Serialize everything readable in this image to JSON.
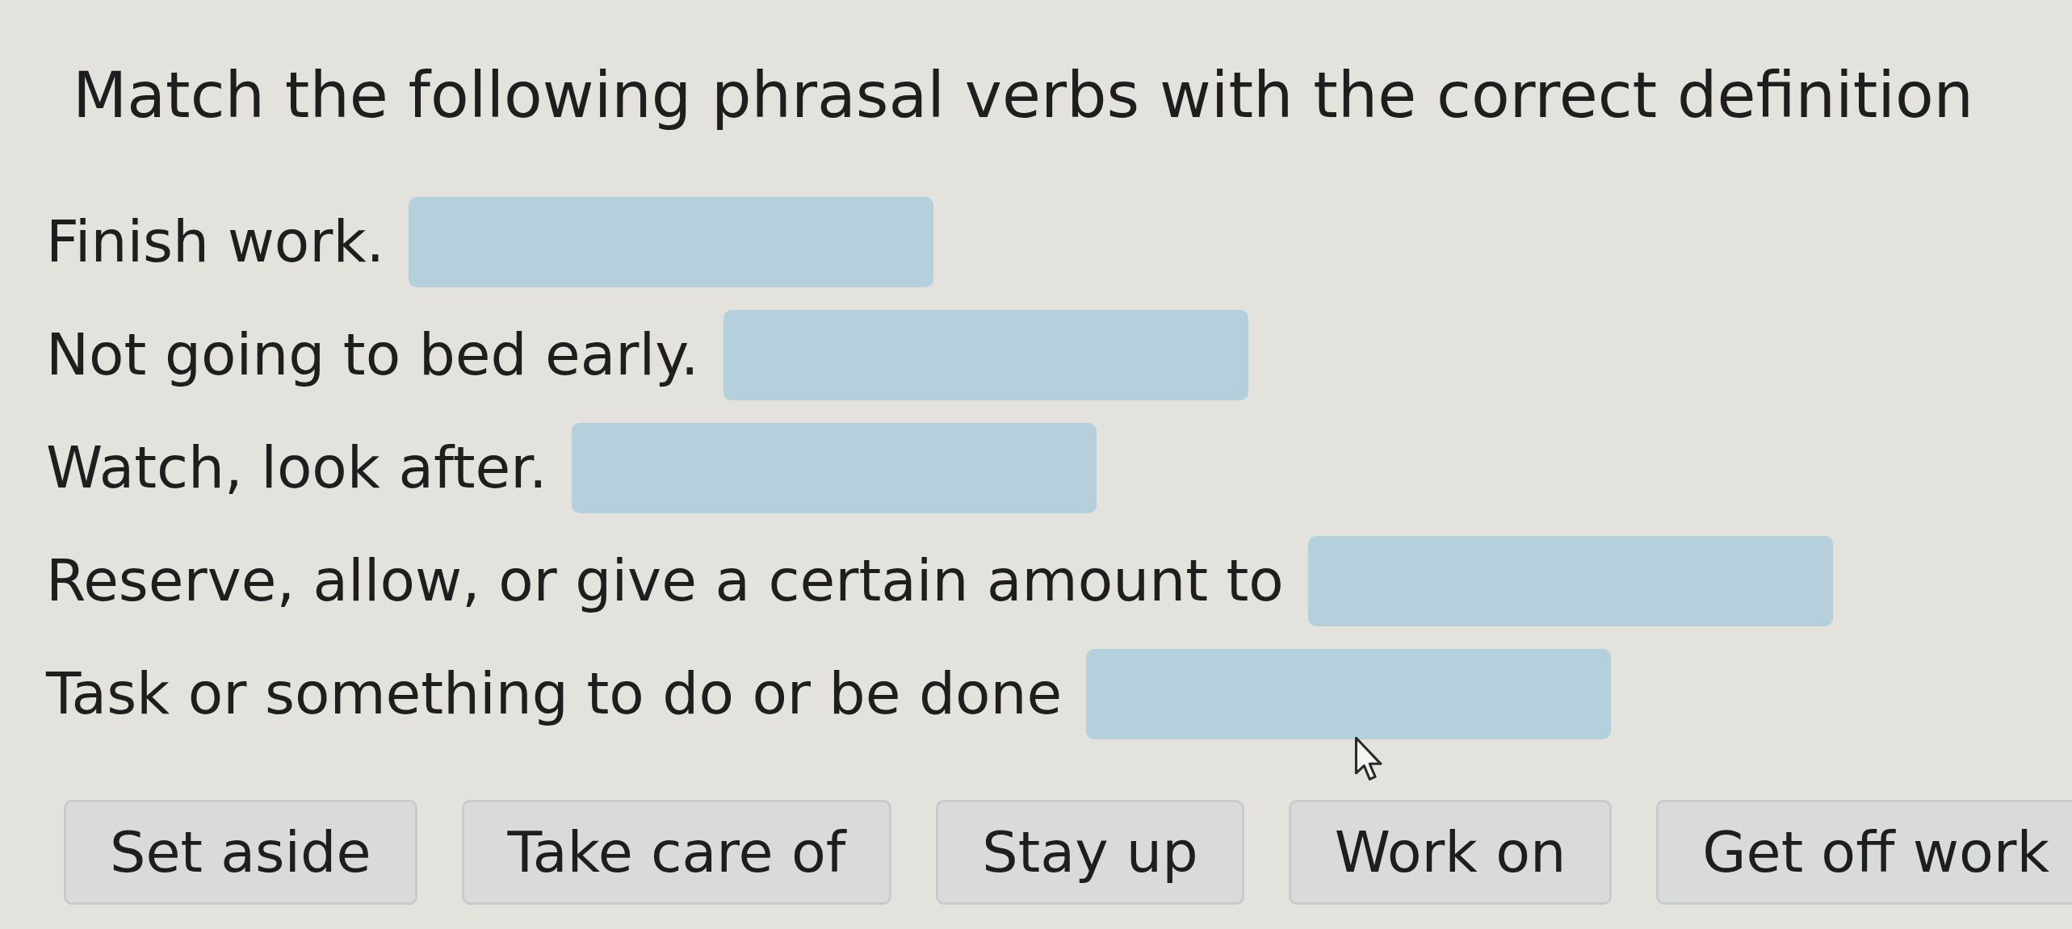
{
  "title": "Match the following phrasal verbs with the correct definition",
  "items": [
    {
      "definition": "Finish work."
    },
    {
      "definition": "Not going to bed early."
    },
    {
      "definition": "Watch, look after."
    },
    {
      "definition": "Reserve, allow, or give a certain amount to"
    },
    {
      "definition": "Task or something to do or be done"
    }
  ],
  "options": [
    {
      "label": "Set aside"
    },
    {
      "label": "Take care of"
    },
    {
      "label": "Stay up"
    },
    {
      "label": "Work on"
    },
    {
      "label": "Get off work"
    }
  ]
}
